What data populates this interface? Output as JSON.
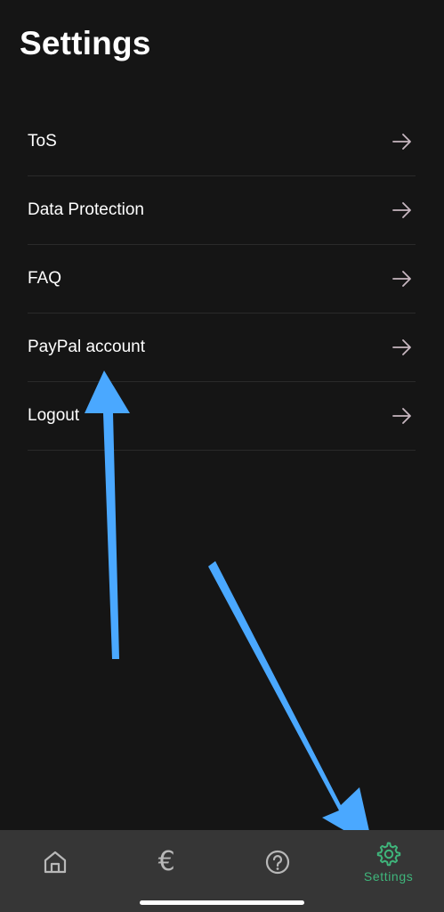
{
  "header": {
    "title": "Settings"
  },
  "settings_items": [
    {
      "label": "ToS",
      "icon": "arrow-right-icon"
    },
    {
      "label": "Data Protection",
      "icon": "arrow-right-icon"
    },
    {
      "label": "FAQ",
      "icon": "arrow-right-icon"
    },
    {
      "label": "PayPal account",
      "icon": "arrow-right-icon"
    },
    {
      "label": "Logout",
      "icon": "arrow-right-icon"
    }
  ],
  "tab_bar": {
    "tabs": [
      {
        "name": "home",
        "icon": "home-icon",
        "label": ""
      },
      {
        "name": "payments",
        "icon": "euro-icon",
        "label": ""
      },
      {
        "name": "help",
        "icon": "help-circle-icon",
        "label": ""
      },
      {
        "name": "settings",
        "icon": "gear-icon",
        "label": "Settings",
        "active": true
      }
    ]
  },
  "annotations": {
    "arrow_color": "#4aa8ff",
    "targets": [
      "PayPal account",
      "Settings"
    ]
  },
  "colors": {
    "background": "#151515",
    "tab_bar": "#363636",
    "accent": "#3fb57b",
    "arrow_icon": "#c7b7c0",
    "divider": "#2a2a2a"
  }
}
